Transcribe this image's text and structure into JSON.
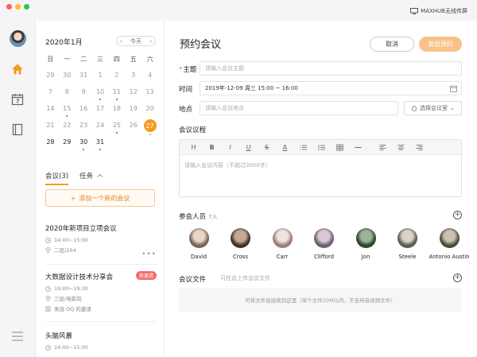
{
  "titlebar": {
    "cast_label": "MAXHUB无线传屏"
  },
  "calendar": {
    "month_label": "2020年1月",
    "today_label": "今天",
    "prev_symbol": "‹",
    "next_symbol": "›",
    "weekdays": [
      "日",
      "一",
      "二",
      "三",
      "四",
      "五",
      "六"
    ],
    "days": [
      {
        "n": "29",
        "cur": false,
        "dot": false,
        "sel": false
      },
      {
        "n": "30",
        "cur": false,
        "dot": false,
        "sel": false
      },
      {
        "n": "31",
        "cur": false,
        "dot": false,
        "sel": false
      },
      {
        "n": "1",
        "cur": false,
        "dot": false,
        "sel": false
      },
      {
        "n": "2",
        "cur": false,
        "dot": false,
        "sel": false
      },
      {
        "n": "3",
        "cur": false,
        "dot": false,
        "sel": false
      },
      {
        "n": "4",
        "cur": false,
        "dot": false,
        "sel": false
      },
      {
        "n": "7",
        "cur": false,
        "dot": false,
        "sel": false
      },
      {
        "n": "8",
        "cur": false,
        "dot": false,
        "sel": false
      },
      {
        "n": "9",
        "cur": false,
        "dot": false,
        "sel": false
      },
      {
        "n": "10",
        "cur": false,
        "dot": true,
        "sel": false
      },
      {
        "n": "11",
        "cur": false,
        "dot": true,
        "sel": false
      },
      {
        "n": "12",
        "cur": false,
        "dot": false,
        "sel": false
      },
      {
        "n": "13",
        "cur": false,
        "dot": false,
        "sel": false
      },
      {
        "n": "14",
        "cur": false,
        "dot": false,
        "sel": false
      },
      {
        "n": "15",
        "cur": false,
        "dot": true,
        "sel": false
      },
      {
        "n": "16",
        "cur": false,
        "dot": false,
        "sel": false
      },
      {
        "n": "17",
        "cur": false,
        "dot": false,
        "sel": false
      },
      {
        "n": "18",
        "cur": false,
        "dot": false,
        "sel": false
      },
      {
        "n": "19",
        "cur": false,
        "dot": false,
        "sel": false
      },
      {
        "n": "20",
        "cur": false,
        "dot": false,
        "sel": false
      },
      {
        "n": "21",
        "cur": false,
        "dot": false,
        "sel": false
      },
      {
        "n": "22",
        "cur": false,
        "dot": false,
        "sel": false
      },
      {
        "n": "23",
        "cur": false,
        "dot": false,
        "sel": false
      },
      {
        "n": "24",
        "cur": false,
        "dot": false,
        "sel": false
      },
      {
        "n": "25",
        "cur": false,
        "dot": true,
        "sel": false
      },
      {
        "n": "26",
        "cur": false,
        "dot": false,
        "sel": false
      },
      {
        "n": "27",
        "cur": true,
        "dot": true,
        "sel": true
      },
      {
        "n": "28",
        "cur": true,
        "dot": false,
        "sel": false
      },
      {
        "n": "29",
        "cur": true,
        "dot": false,
        "sel": false
      },
      {
        "n": "30",
        "cur": true,
        "dot": true,
        "sel": false
      },
      {
        "n": "31",
        "cur": true,
        "dot": true,
        "sel": false
      }
    ]
  },
  "meetings": {
    "tab_meetings": "会议(3)",
    "tab_tasks": "任务",
    "add_label": "添加一个新的会议",
    "items": [
      {
        "title": "2020年新项目立项会议",
        "time": "14:00~15:00",
        "place": "二层/204",
        "badge": "",
        "invite": ""
      },
      {
        "title": "大数据设计技术分享会",
        "time": "19:00~19:30",
        "place": "三层/电影院",
        "badge": "新邀请",
        "invite": "来自 DQ 的邀请"
      },
      {
        "title": "头脑风暴",
        "time": "14:00~15:00",
        "place": "",
        "badge": "",
        "invite": ""
      }
    ]
  },
  "form": {
    "title": "预约会议",
    "cancel_label": "取消",
    "send_label": "发出预约",
    "subject_label": "主题",
    "subject_placeholder": "请输入会议主题",
    "time_label": "时间",
    "time_value": "2019年-12-09 周三 15:00 ~ 16:00",
    "location_label": "地点",
    "location_placeholder": "请输入会议地点",
    "choose_room_label": "选择会议室",
    "agenda_label": "会议议程",
    "agenda_placeholder": "请输入会议内容（不超过3000字）",
    "toolbar": [
      "H",
      "B",
      "I",
      "U",
      "S",
      "A"
    ],
    "attendees_label": "参会人员",
    "attendees_count": "7人",
    "attendees": [
      {
        "name": "David",
        "c1": "#e9d6c8",
        "c2": "#7a6257"
      },
      {
        "name": "Cross",
        "c1": "#c8a893",
        "c2": "#3b3432"
      },
      {
        "name": "Carr",
        "c1": "#f0e3df",
        "c2": "#9a7d74"
      },
      {
        "name": "Clifford",
        "c1": "#d9c8d6",
        "c2": "#6f5f6c"
      },
      {
        "name": "Jon",
        "c1": "#9cb39a",
        "c2": "#2f4330"
      },
      {
        "name": "Steele",
        "c1": "#dad4c7",
        "c2": "#5b5a55"
      },
      {
        "name": "Antonio Austin",
        "c1": "#c9c2b0",
        "c2": "#4e4a40"
      }
    ],
    "files_label": "会议文件",
    "files_hint": "可在此上传会议文件",
    "dropzone_text": "可将文件直接拖到这里（单个文件10M以内，不支持音视频文件）"
  },
  "colors": {
    "accent": "#f59a23",
    "accent_light": "#f9c28a",
    "badge": "#f56c6c"
  }
}
